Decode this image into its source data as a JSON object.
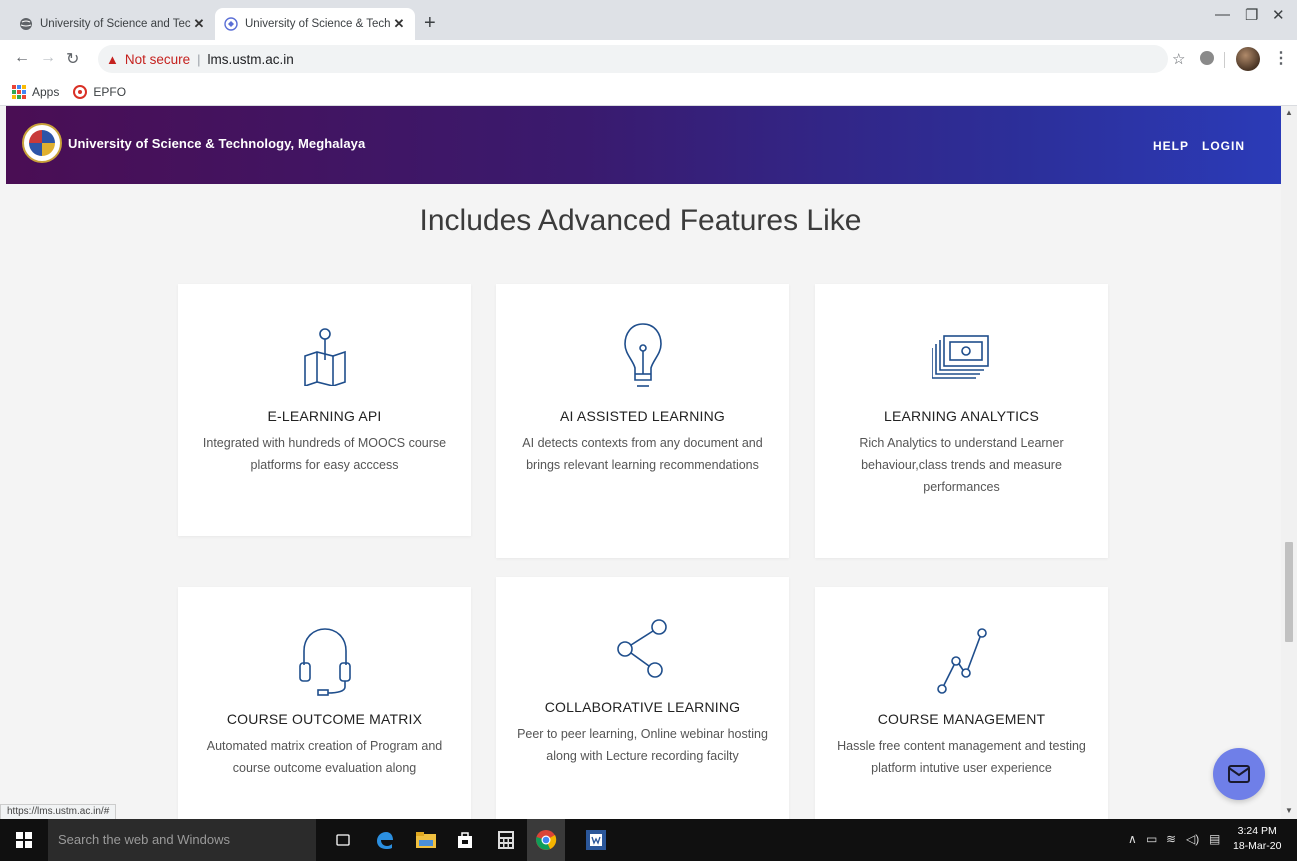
{
  "browser": {
    "tabs": [
      {
        "title": "University of Science and Techno",
        "active": false
      },
      {
        "title": "University of Science & Technolo",
        "active": true
      }
    ],
    "new_tab_symbol": "+",
    "not_secure_label": "Not secure",
    "url": "lms.ustm.ac.in",
    "bookmarks": [
      {
        "label": "Apps",
        "icon": "apps-grid-icon"
      },
      {
        "label": "EPFO",
        "icon": "epfo-icon"
      }
    ],
    "status_url": "https://lms.ustm.ac.in/#"
  },
  "site": {
    "name": "University of Science & Technology, Meghalaya",
    "nav": {
      "help": "HELP",
      "login": "LOGIN"
    },
    "colors": {
      "header_start": "#4a0e54",
      "header_end": "#2b3bb8",
      "icon_blue": "#1f4e8c",
      "chat_button": "#6f7fe8"
    }
  },
  "features": {
    "title": "Includes Advanced Features Like",
    "cards": [
      {
        "icon": "map-pin-icon",
        "title": "E-LEARNING API",
        "text": "Integrated with hundreds of MOOCS course platforms for easy acccess"
      },
      {
        "icon": "light-bulb-icon",
        "title": "AI ASSISTED LEARNING",
        "text": "AI detects contexts from any document and brings relevant learning recommendations"
      },
      {
        "icon": "money-stack-icon",
        "title": "LEARNING ANALYTICS",
        "text": "Rich Analytics to understand Learner behaviour,class trends and measure performances"
      },
      {
        "icon": "headset-icon",
        "title": "COURSE OUTCOME MATRIX",
        "text": "Automated matrix creation of Program and course outcome evaluation along"
      },
      {
        "icon": "share-icon",
        "title": "COLLABORATIVE LEARNING",
        "text": "Peer to peer learning, Online webinar hosting along with Lecture recording facilty"
      },
      {
        "icon": "line-graph-icon",
        "title": "COURSE MANAGEMENT",
        "text": "Hassle free content management and testing platform intutive user experience"
      }
    ]
  },
  "taskbar": {
    "search_placeholder": "Search the web and Windows",
    "time": "3:24 PM",
    "date": "18-Mar-20"
  }
}
